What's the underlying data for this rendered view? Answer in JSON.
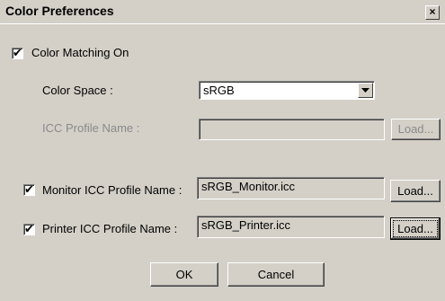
{
  "dialog": {
    "title": "Color Preferences",
    "close_glyph": "×"
  },
  "color_matching": {
    "label": "Color Matching On",
    "checked": true
  },
  "color_space": {
    "label": "Color Space :",
    "value": "sRGB"
  },
  "icc_profile": {
    "label": "ICC Profile Name :",
    "value": "",
    "load_label": "Load..."
  },
  "monitor_profile": {
    "label": "Monitor ICC Profile Name :",
    "checked": true,
    "value": "sRGB_Monitor.icc",
    "load_label": "Load..."
  },
  "printer_profile": {
    "label": "Printer ICC Profile Name :",
    "checked": true,
    "value": "sRGB_Printer.icc",
    "load_label": "Load..."
  },
  "buttons": {
    "ok": "OK",
    "cancel": "Cancel"
  },
  "icons": {
    "check": "✔",
    "dropdown": "dropdown-arrow-icon"
  }
}
